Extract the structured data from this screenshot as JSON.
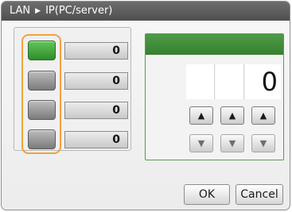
{
  "title": {
    "left": "LAN",
    "separator": "▶",
    "right": "IP(PC/server)"
  },
  "selectors": [
    {
      "value": "0",
      "active": true
    },
    {
      "value": "0",
      "active": false
    },
    {
      "value": "0",
      "active": false
    },
    {
      "value": "0",
      "active": false
    }
  ],
  "editor": {
    "digits": [
      "",
      "",
      "0"
    ],
    "up_symbol": "▲",
    "down_symbol": "▼"
  },
  "buttons": {
    "ok": "OK",
    "cancel": "Cancel"
  },
  "colors": {
    "active_green": "#3a9a34",
    "highlight_orange": "#f2a23b",
    "title_bar": "#5c5c5c"
  }
}
